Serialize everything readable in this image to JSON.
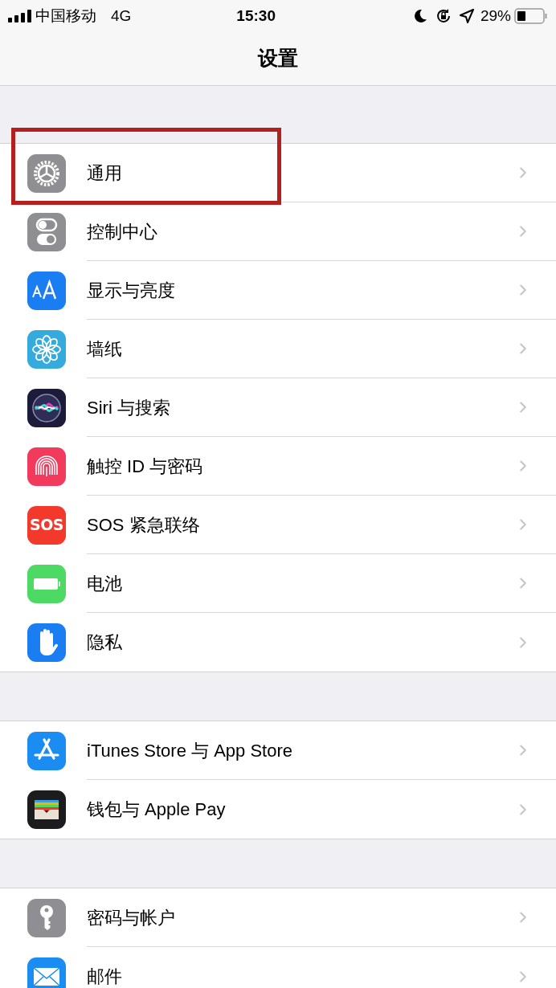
{
  "status_bar": {
    "carrier": "中国移动",
    "network": "4G",
    "time": "15:30",
    "battery": "29%"
  },
  "nav": {
    "title": "设置"
  },
  "groups": [
    {
      "items": [
        {
          "kind": "gear",
          "label": "通用",
          "highlighted": true
        },
        {
          "kind": "switches",
          "label": "控制中心",
          "highlighted": false
        },
        {
          "kind": "text-size",
          "label": "显示与亮度",
          "highlighted": false
        },
        {
          "kind": "flower",
          "label": "墙纸",
          "highlighted": false
        },
        {
          "kind": "siri",
          "label": "Siri 与搜索",
          "highlighted": false
        },
        {
          "kind": "fingerprint",
          "label": "触控 ID 与密码",
          "highlighted": false
        },
        {
          "kind": "sos",
          "label": "SOS 紧急联络",
          "icon_text": "SOS",
          "highlighted": false
        },
        {
          "kind": "battery",
          "label": "电池",
          "highlighted": false
        },
        {
          "kind": "hand",
          "label": "隐私",
          "highlighted": false
        }
      ]
    },
    {
      "items": [
        {
          "kind": "app-store",
          "label": "iTunes Store 与 App Store",
          "highlighted": false
        },
        {
          "kind": "wallet",
          "label": "钱包与 Apple Pay",
          "highlighted": false
        }
      ]
    },
    {
      "items": [
        {
          "kind": "key",
          "label": "密码与帐户",
          "highlighted": false
        },
        {
          "kind": "mail",
          "label": "邮件",
          "highlighted": false
        }
      ]
    }
  ]
}
